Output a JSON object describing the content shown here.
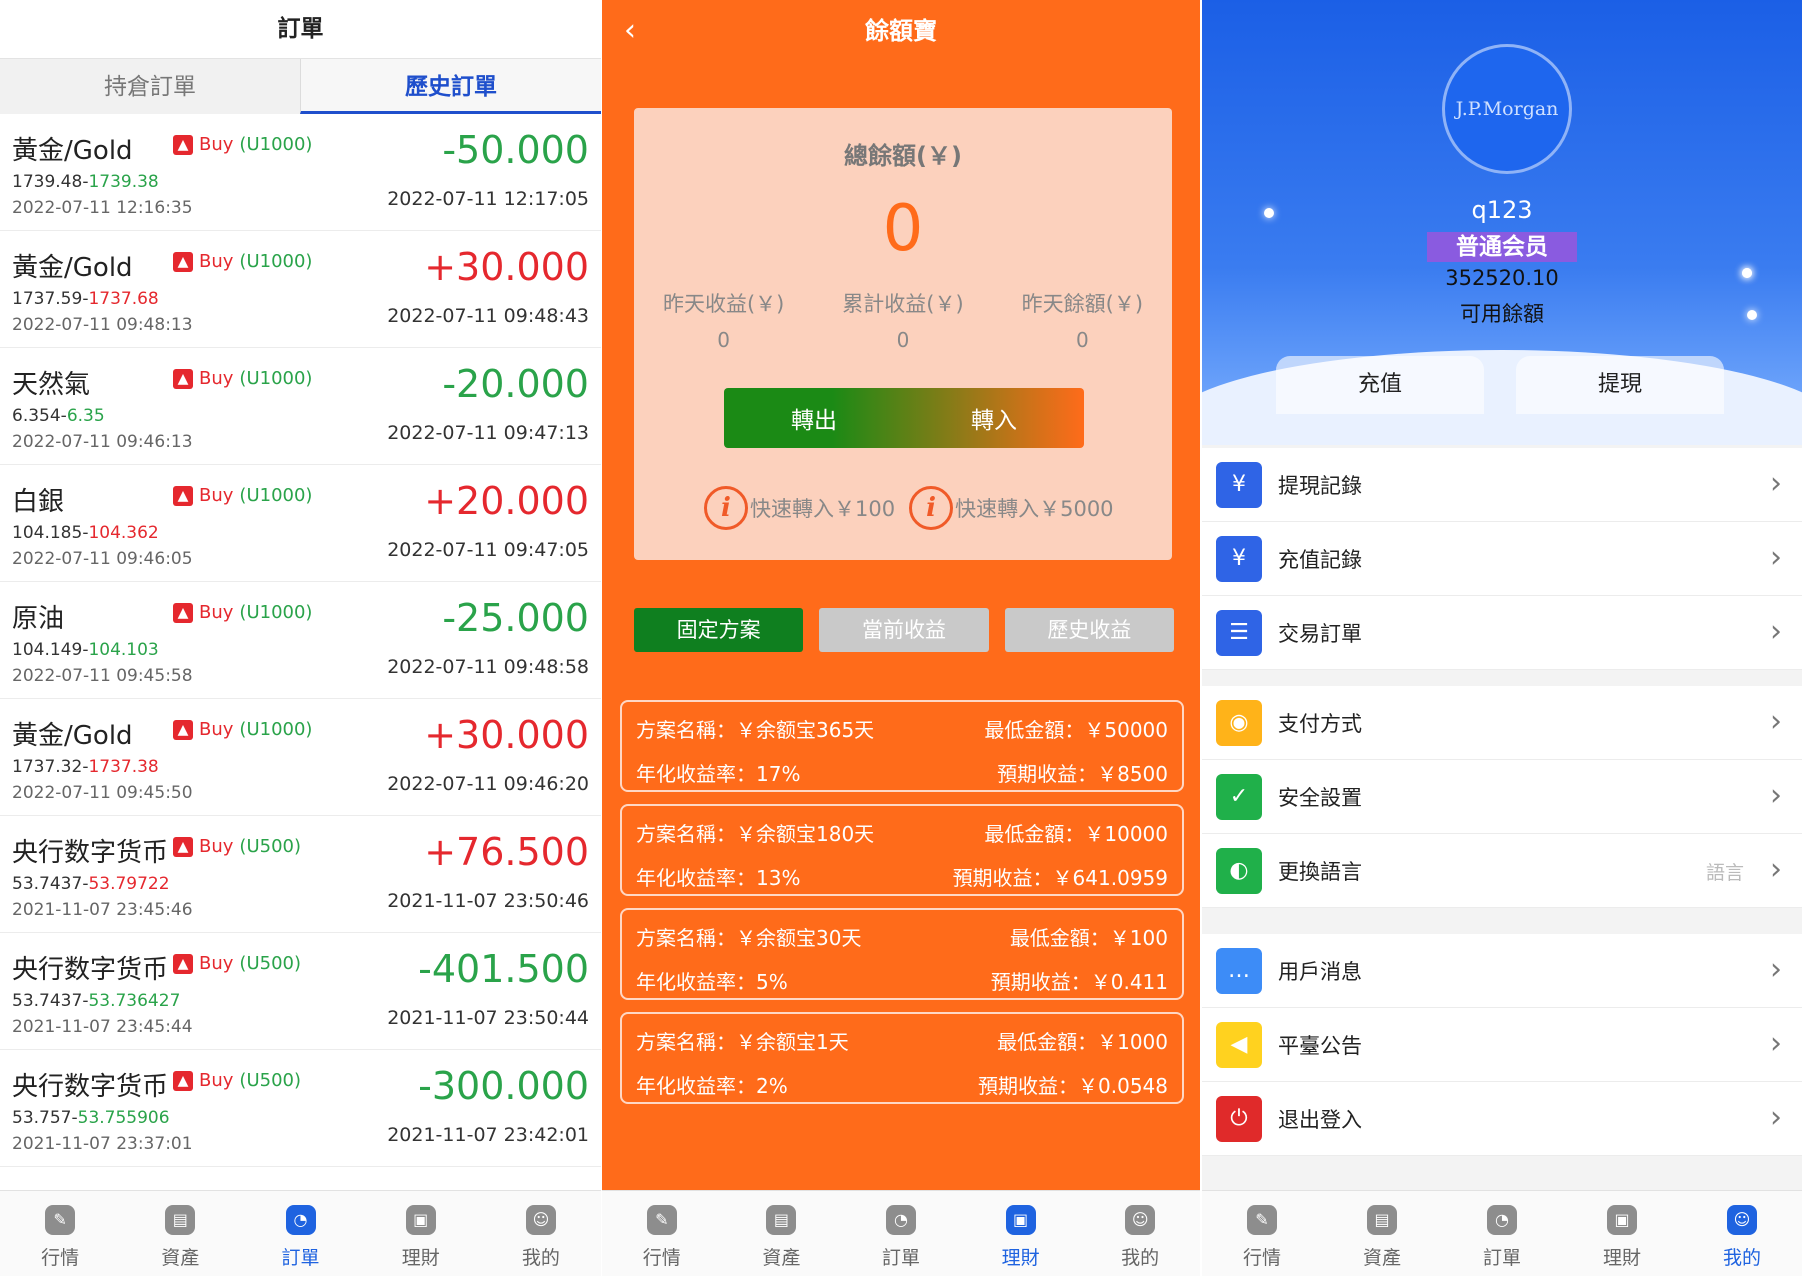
{
  "screen1": {
    "title": "訂單",
    "tabs": [
      "持倉訂單",
      "歷史訂單"
    ],
    "orders": [
      {
        "name": "黃金/Gold",
        "side": "Buy",
        "unit": "(U1000)",
        "open": "1739.48",
        "close": "1739.38",
        "close_dir": "neg",
        "time_open": "2022-07-11 12:16:35",
        "pnl": "-50.000",
        "pnl_dir": "neg",
        "time_close": "2022-07-11 12:17:05"
      },
      {
        "name": "黃金/Gold",
        "side": "Buy",
        "unit": "(U1000)",
        "open": "1737.59",
        "close": "1737.68",
        "close_dir": "pos",
        "time_open": "2022-07-11 09:48:13",
        "pnl": "+30.000",
        "pnl_dir": "pos",
        "time_close": "2022-07-11 09:48:43"
      },
      {
        "name": "天然氣",
        "side": "Buy",
        "unit": "(U1000)",
        "open": "6.354",
        "close": "6.35",
        "close_dir": "neg",
        "time_open": "2022-07-11 09:46:13",
        "pnl": "-20.000",
        "pnl_dir": "neg",
        "time_close": "2022-07-11 09:47:13"
      },
      {
        "name": "白銀",
        "side": "Buy",
        "unit": "(U1000)",
        "open": "104.185",
        "close": "104.362",
        "close_dir": "pos",
        "time_open": "2022-07-11 09:46:05",
        "pnl": "+20.000",
        "pnl_dir": "pos",
        "time_close": "2022-07-11 09:47:05"
      },
      {
        "name": "原油",
        "side": "Buy",
        "unit": "(U1000)",
        "open": "104.149",
        "close": "104.103",
        "close_dir": "neg",
        "time_open": "2022-07-11 09:45:58",
        "pnl": "-25.000",
        "pnl_dir": "neg",
        "time_close": "2022-07-11 09:48:58"
      },
      {
        "name": "黃金/Gold",
        "side": "Buy",
        "unit": "(U1000)",
        "open": "1737.32",
        "close": "1737.38",
        "close_dir": "pos",
        "time_open": "2022-07-11 09:45:50",
        "pnl": "+30.000",
        "pnl_dir": "pos",
        "time_close": "2022-07-11 09:46:20"
      },
      {
        "name": "央行数字货币",
        "side": "Buy",
        "unit": "(U500)",
        "open": "53.7437",
        "close": "53.79722",
        "close_dir": "pos",
        "time_open": "2021-11-07 23:45:46",
        "pnl": "+76.500",
        "pnl_dir": "pos",
        "time_close": "2021-11-07 23:50:46"
      },
      {
        "name": "央行数字货币",
        "side": "Buy",
        "unit": "(U500)",
        "open": "53.7437",
        "close": "53.736427",
        "close_dir": "neg",
        "time_open": "2021-11-07 23:45:44",
        "pnl": "-401.500",
        "pnl_dir": "neg",
        "time_close": "2021-11-07 23:50:44"
      },
      {
        "name": "央行数字货币",
        "side": "Buy",
        "unit": "(U500)",
        "open": "53.757",
        "close": "53.755906",
        "close_dir": "neg",
        "time_open": "2021-11-07 23:37:01",
        "pnl": "-300.000",
        "pnl_dir": "neg",
        "time_close": "2021-11-07 23:42:01"
      }
    ],
    "tabbar": [
      "行情",
      "資產",
      "訂單",
      "理財",
      "我的"
    ],
    "active_tab": 2
  },
  "screen2": {
    "title": "餘額寶",
    "total_label": "總餘額(￥)",
    "total_value": "0",
    "stats": [
      {
        "label": "昨天收益(￥)",
        "value": "0"
      },
      {
        "label": "累計收益(￥)",
        "value": "0"
      },
      {
        "label": "昨天餘額(￥)",
        "value": "0"
      }
    ],
    "transfer_out": "轉出",
    "transfer_in": "轉入",
    "quick": [
      "快速轉入￥100",
      "快速轉入￥5000"
    ],
    "plan_tabs": [
      "固定方案",
      "當前收益",
      "歷史收益"
    ],
    "plans": [
      {
        "name": "方案名稱：￥余额宝365天",
        "min": "最低金額：￥50000",
        "rate": "年化收益率：17%",
        "expect": "預期收益：￥8500"
      },
      {
        "name": "方案名稱：￥余额宝180天",
        "min": "最低金額：￥10000",
        "rate": "年化收益率：13%",
        "expect": "預期收益：￥641.0959"
      },
      {
        "name": "方案名稱：￥余额宝30天",
        "min": "最低金額：￥100",
        "rate": "年化收益率：5%",
        "expect": "預期收益：￥0.411"
      },
      {
        "name": "方案名稱：￥余额宝1天",
        "min": "最低金額：￥1000",
        "rate": "年化收益率：2%",
        "expect": "預期收益：￥0.0548"
      }
    ],
    "tabbar": [
      "行情",
      "資產",
      "訂單",
      "理財",
      "我的"
    ],
    "active_tab": 3
  },
  "screen3": {
    "logo": "J.P.Morgan",
    "username": "q123",
    "level": "普通会员",
    "balance": "352520.10",
    "balance_label": "可用餘額",
    "recharge": "充值",
    "withdraw": "提現",
    "menu_groups": [
      [
        {
          "label": "提現記錄",
          "icon": "yen-doc-icon",
          "color": "#2f64e6",
          "glyph": "¥"
        },
        {
          "label": "充值記錄",
          "icon": "yen-doc-icon",
          "color": "#2f64e6",
          "glyph": "¥"
        },
        {
          "label": "交易訂單",
          "icon": "clipboard-icon",
          "color": "#2f64e6",
          "glyph": "☰"
        }
      ],
      [
        {
          "label": "支付方式",
          "icon": "wallet-icon",
          "color": "#ffb319",
          "glyph": "◉"
        },
        {
          "label": "安全設置",
          "icon": "shield-icon",
          "color": "#20b04a",
          "glyph": "✓"
        },
        {
          "label": "更換語言",
          "icon": "globe-icon",
          "color": "#20b04a",
          "glyph": "◐",
          "extra": "語言"
        }
      ],
      [
        {
          "label": "用戶消息",
          "icon": "chat-icon",
          "color": "#3d8cf7",
          "glyph": "…"
        },
        {
          "label": "平臺公告",
          "icon": "megaphone-icon",
          "color": "#ffd21f",
          "glyph": "◀"
        },
        {
          "label": "退出登入",
          "icon": "power-icon",
          "color": "#e02a2a",
          "glyph": "⏻"
        }
      ]
    ],
    "tabbar": [
      "行情",
      "資產",
      "訂單",
      "理財",
      "我的"
    ],
    "active_tab": 4
  }
}
